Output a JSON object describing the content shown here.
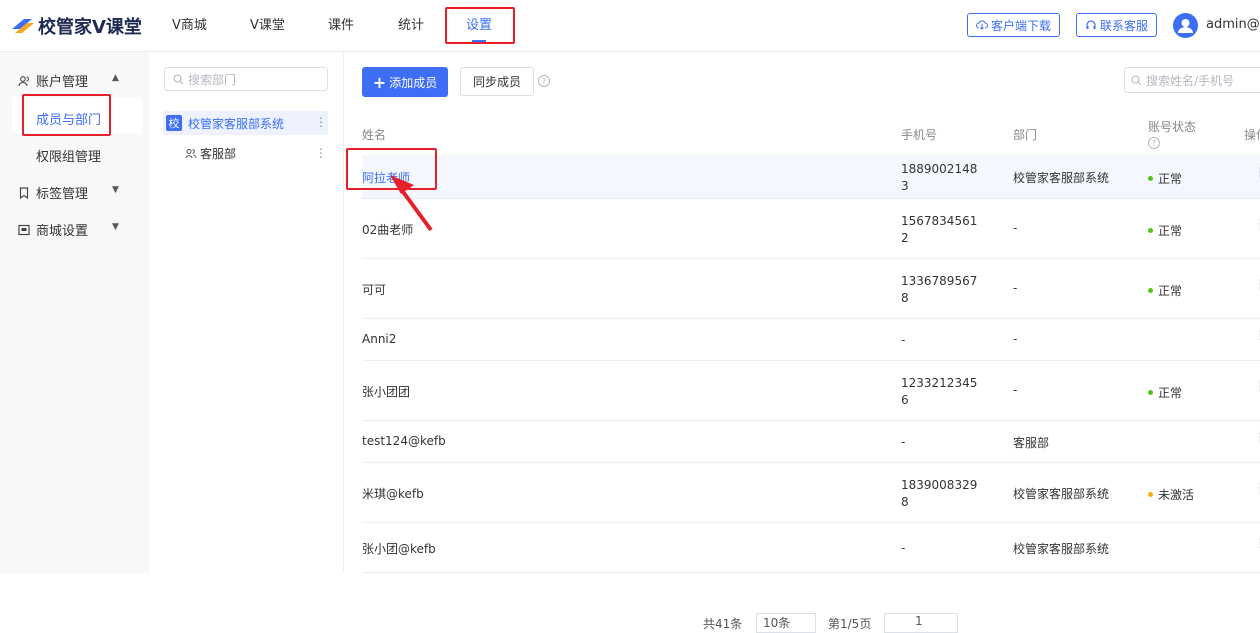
{
  "app": {
    "logo_text": "校管家V课堂"
  },
  "nav": [
    {
      "label": "V商城"
    },
    {
      "label": "V课堂"
    },
    {
      "label": "课件"
    },
    {
      "label": "统计"
    },
    {
      "label": "设置",
      "active": true
    }
  ],
  "topbar": {
    "download_label": "客户端下载",
    "support_label": "联系客服",
    "user_name": "admin@k"
  },
  "sidebar": {
    "account_group": "账户管理",
    "items": [
      {
        "label": "成员与部门",
        "active": true
      },
      {
        "label": "权限组管理"
      }
    ],
    "tag_group": "标签管理",
    "mall_group": "商城设置"
  },
  "dept_panel": {
    "search_placeholder": "搜索部门",
    "root_badge": "校",
    "root_label": "校管家客服部系统",
    "child_label": "客服部"
  },
  "main": {
    "add_member_label": "添加成员",
    "sync_member_label": "同步成员",
    "member_search_placeholder": "搜索姓名/手机号",
    "columns": {
      "name": "姓名",
      "phone": "手机号",
      "dept": "部门",
      "status": "账号状态",
      "op": "操作"
    },
    "rows": [
      {
        "name": "阿拉老师",
        "phone": "18890021483",
        "dept": "校管家客服部系统",
        "status": "正常",
        "status_color": "#52c41a",
        "highlighted": true
      },
      {
        "name": "02曲老师",
        "phone": "15678345612",
        "dept": "-",
        "status": "正常",
        "status_color": "#52c41a"
      },
      {
        "name": "可可",
        "phone": "13367895678",
        "dept": "-",
        "status": "正常",
        "status_color": "#52c41a"
      },
      {
        "name": "Anni2",
        "phone": "-",
        "dept": "-",
        "status": ""
      },
      {
        "name": "张小团团",
        "phone": "12332123456",
        "dept": "-",
        "status": "正常",
        "status_color": "#52c41a"
      },
      {
        "name": "test124@kefb",
        "phone": "-",
        "dept": "客服部",
        "status": ""
      },
      {
        "name": "米琪@kefb",
        "phone": "18390083298",
        "dept": "校管家客服部系统",
        "status": "未激活",
        "status_color": "#faad14"
      },
      {
        "name": "张小团@kefb",
        "phone": "-",
        "dept": "校管家客服部系统",
        "status": ""
      }
    ]
  },
  "pagination": {
    "total": "共41条",
    "page_size": "10条",
    "page_info": "第1/5页",
    "current_page": "1"
  },
  "colors": {
    "accent": "#3d6ef5",
    "annotation": "#e5202a"
  }
}
